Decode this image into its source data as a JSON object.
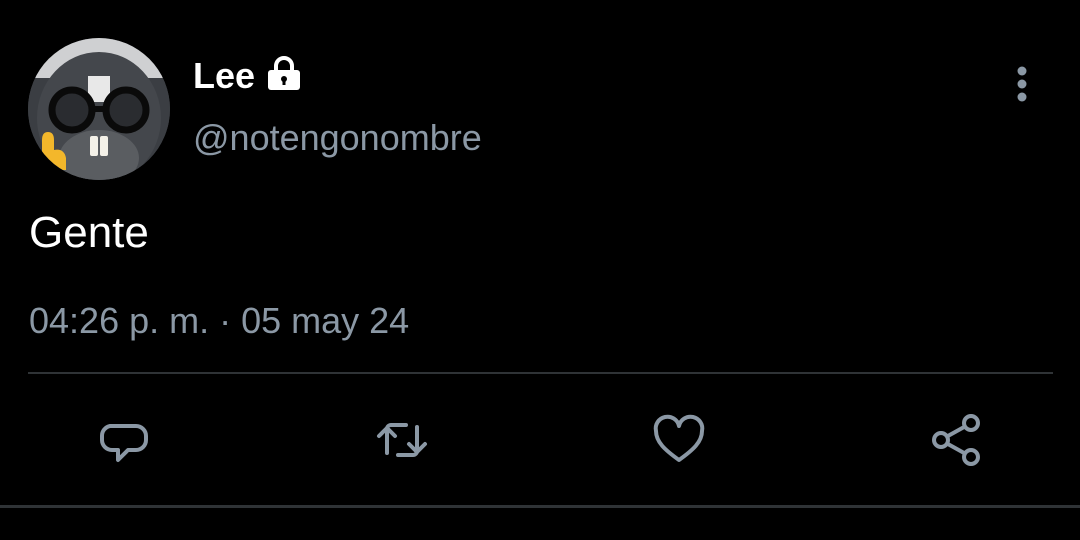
{
  "author": {
    "display_name": "Lee",
    "handle": "@notengonombre",
    "protected": true
  },
  "tweet": {
    "text": "Gente",
    "timestamp": "04:26 p. m. · 05 may 24"
  },
  "icons": {
    "lock": "lock-icon",
    "more": "more-vertical-icon",
    "reply": "reply-icon",
    "retweet": "retweet-icon",
    "like": "heart-icon",
    "share": "share-icon"
  },
  "colors": {
    "background": "#000000",
    "primary_text": "#ffffff",
    "secondary_text": "#8b98a5",
    "divider": "#2f3336",
    "icon": "#8b98a5"
  }
}
